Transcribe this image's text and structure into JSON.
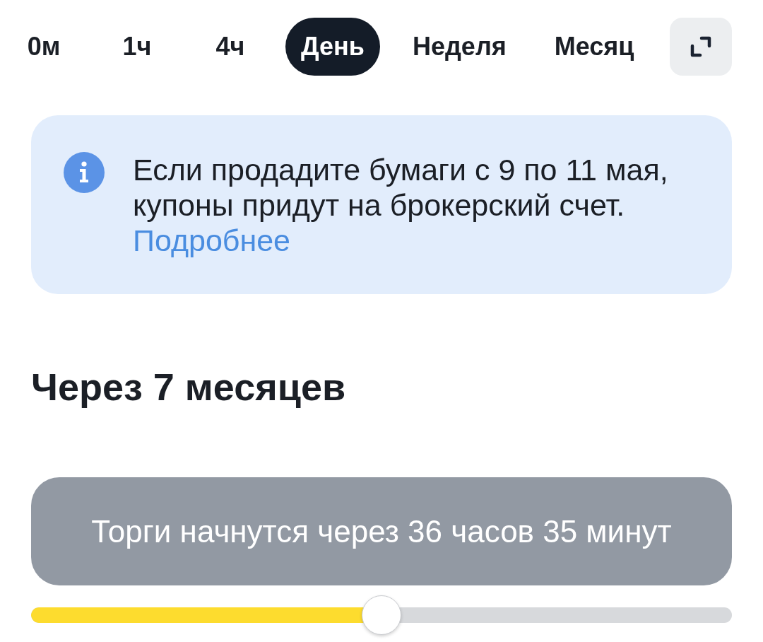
{
  "timeframes": [
    {
      "label": "0м",
      "selected": false
    },
    {
      "label": "1ч",
      "selected": false
    },
    {
      "label": "4ч",
      "selected": false
    },
    {
      "label": "День",
      "selected": true
    },
    {
      "label": "Неделя",
      "selected": false
    },
    {
      "label": "Месяц",
      "selected": false
    }
  ],
  "info_banner": {
    "text": "Если продадите бумаги с 9 по 11 мая, купоны придут на брокерский счет.",
    "link": "Подробнее"
  },
  "section_title": "Через 7 месяцев",
  "toast": {
    "text": "Торги начнутся через 36 часов 35 минут"
  },
  "slider": {
    "level": 0.5
  }
}
